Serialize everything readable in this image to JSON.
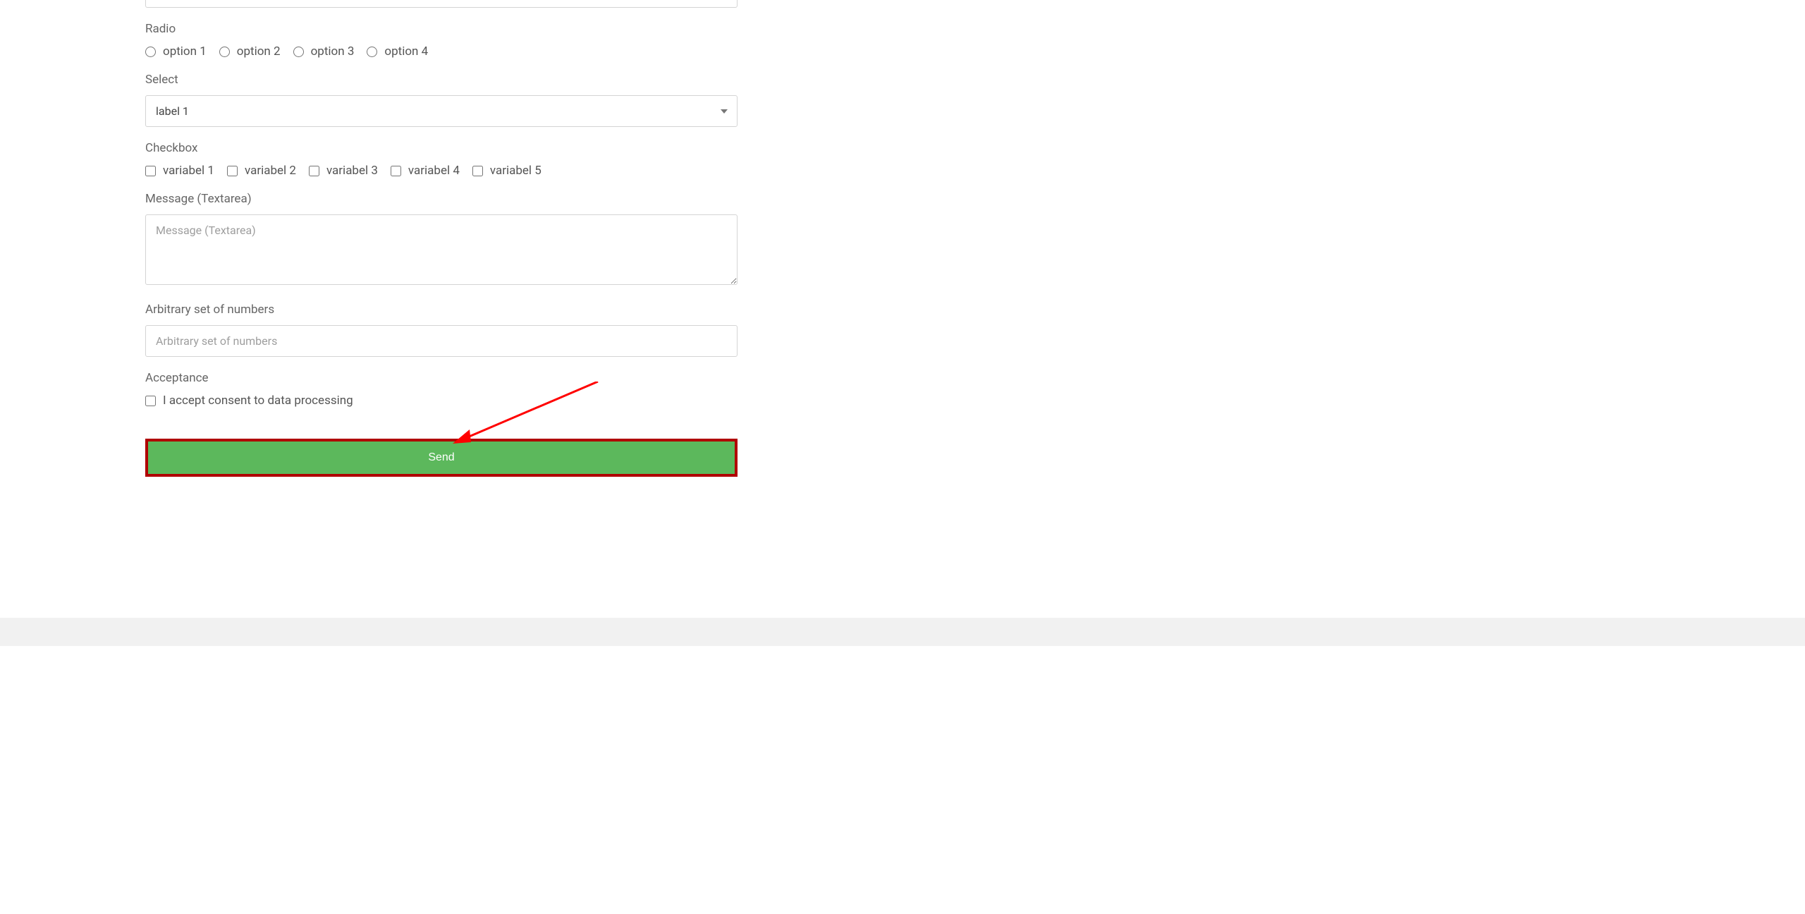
{
  "form": {
    "radio": {
      "label": "Radio",
      "options": [
        "option 1",
        "option 2",
        "option 3",
        "option 4"
      ]
    },
    "select": {
      "label": "Select",
      "value": "label 1"
    },
    "checkbox": {
      "label": "Checkbox",
      "options": [
        "variabel 1",
        "variabel 2",
        "variabel 3",
        "variabel 4",
        "variabel 5"
      ]
    },
    "message": {
      "label": "Message (Textarea)",
      "placeholder": "Message (Textarea)"
    },
    "numbers": {
      "label": "Arbitrary set of numbers",
      "placeholder": "Arbitrary set of numbers"
    },
    "acceptance": {
      "label": "Acceptance",
      "text": "I accept consent to data processing"
    },
    "submit_label": "Send"
  },
  "annotation": {
    "highlight_color": "#b00000",
    "arrow_color": "#ff0000"
  }
}
